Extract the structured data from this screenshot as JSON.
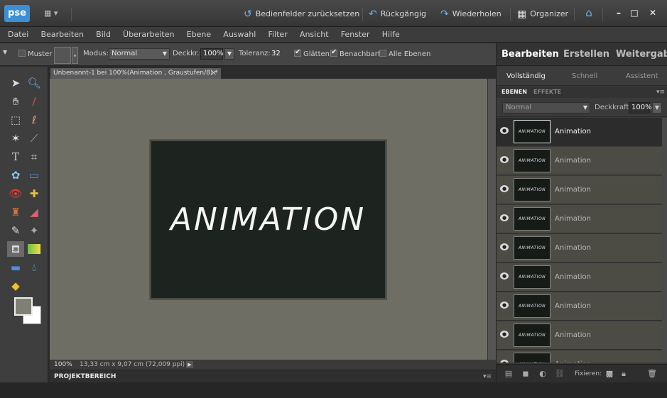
{
  "app": {
    "logo_text": "pse",
    "colors": {
      "accent": "#3b8fd6",
      "canvas_bg": "#6e6e64",
      "doc_bg": "#1d2420"
    }
  },
  "titlebar": {
    "reset_panels": "Bedienfelder zurücksetzen",
    "undo": "Rückgängig",
    "redo": "Wiederholen",
    "organizer": "Organizer",
    "minimize": "–",
    "maximize": "□",
    "close": "✕"
  },
  "menu": [
    "Datei",
    "Bearbeiten",
    "Bild",
    "Überarbeiten",
    "Ebene",
    "Auswahl",
    "Filter",
    "Ansicht",
    "Fenster",
    "Hilfe"
  ],
  "options": {
    "pattern_label": "Muster",
    "mode_label": "Modus:",
    "mode_value": "Normal",
    "opacity_label": "Deckkr.:",
    "opacity_value": "100%",
    "tolerance_label": "Toleranz:",
    "tolerance_value": "32",
    "smooth_label": "Glätten",
    "contiguous_label": "Benachbart",
    "all_layers_label": "Alle Ebenen"
  },
  "document": {
    "tab_title": "Unbenannt-1 bei 100%(Animation , Graustufen/8) *",
    "canvas_text": "ANIMATION",
    "zoom": "100%",
    "size_info": "13,33 cm x 9,07 cm (72,009 ppi)"
  },
  "project_bin": {
    "label": "PROJEKTBEREICH"
  },
  "panel": {
    "tabs": [
      "Bearbeiten",
      "Erstellen",
      "Weitergabe"
    ],
    "modes": [
      "Vollständig",
      "Schnell",
      "Assistent"
    ],
    "palette_tabs": [
      "EBENEN",
      "EFFEKTE"
    ],
    "blend_mode": "Normal",
    "opacity_label": "Deckkraft:",
    "opacity_value": "100%",
    "layers": [
      {
        "name": "Animation",
        "thumb": "ANIMATION",
        "selected": true
      },
      {
        "name": "Animation",
        "thumb": "ANIMATION"
      },
      {
        "name": "Animation",
        "thumb": "ANIMATION"
      },
      {
        "name": "Animation",
        "thumb": "ANIMATION"
      },
      {
        "name": "Animation",
        "thumb": "ANIMATION"
      },
      {
        "name": "Animation",
        "thumb": "ANIMATION"
      },
      {
        "name": "Animation",
        "thumb": "ANIMATION"
      },
      {
        "name": "Animation",
        "thumb": "ANIMATION"
      },
      {
        "name": "Animation",
        "thumb": "ANIMATION"
      }
    ],
    "lock_label": "Fixieren:"
  }
}
